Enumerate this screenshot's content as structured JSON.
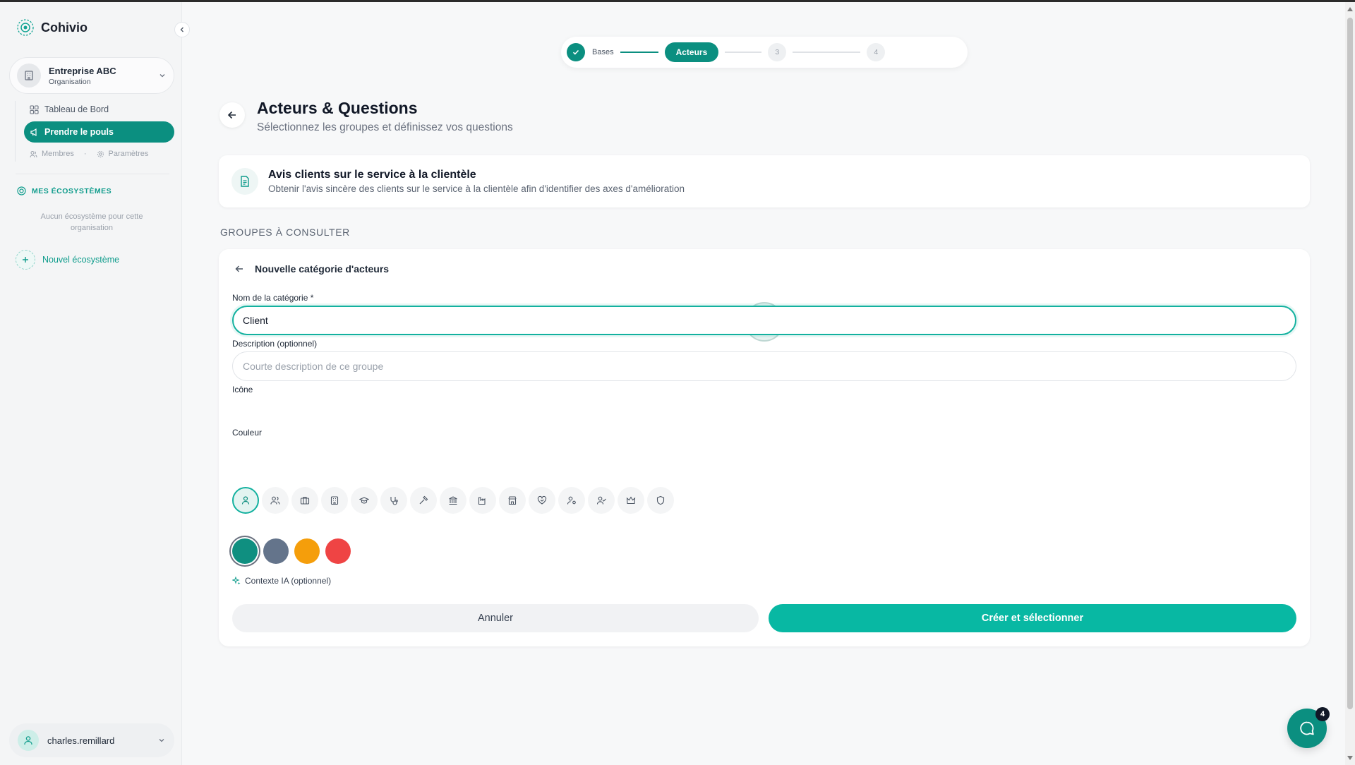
{
  "brand": {
    "name": "Cohivio"
  },
  "sidebar": {
    "org": {
      "name": "Entreprise ABC",
      "type": "Organisation"
    },
    "nav": [
      {
        "label": "Tableau de Bord",
        "icon": "grid-icon"
      },
      {
        "label": "Prendre le pouls",
        "icon": "megaphone-icon",
        "active": true
      }
    ],
    "sub_links": [
      {
        "label": "Membres",
        "icon": "users-icon"
      },
      {
        "label": "Paramètres",
        "icon": "gear-icon"
      }
    ],
    "section_label": "MES ÉCOSYSTÈMES",
    "empty_text": "Aucun écosystème pour cette organisation",
    "new_ecosystem": "Nouvel écosystème",
    "user": {
      "name": "charles.remillard"
    }
  },
  "stepper": {
    "steps": [
      {
        "label": "Bases",
        "state": "done"
      },
      {
        "label": "Acteurs",
        "state": "active"
      },
      {
        "label": "3",
        "state": "pending"
      },
      {
        "label": "4",
        "state": "pending"
      }
    ]
  },
  "page": {
    "title": "Acteurs & Questions",
    "subtitle": "Sélectionnez les groupes et définissez vos questions"
  },
  "survey": {
    "title": "Avis clients sur le service à la clientèle",
    "description": "Obtenir l'avis sincère des clients sur le service à la clientèle afin d'identifier des axes d'amélioration"
  },
  "groups_label": "GROUPES À CONSULTER",
  "form": {
    "title": "Nouvelle catégorie d'acteurs",
    "name_label": "Nom de la catégorie *",
    "name_value": "Client",
    "description_label": "Description (optionnel)",
    "description_placeholder": "Courte description de ce groupe",
    "icon_label": "Icône",
    "icons": [
      "user-icon",
      "users-icon",
      "briefcase-icon",
      "building-icon",
      "graduation-cap-icon",
      "stethoscope-icon",
      "hammer-icon",
      "landmark-icon",
      "factory-icon",
      "store-icon",
      "heart-handshake-icon",
      "user-cog-icon",
      "user-check-icon",
      "crown-icon",
      "shield-icon"
    ],
    "selected_icon": "user-icon",
    "color_label": "Couleur",
    "colors": [
      "#0f8f80",
      "#64748b",
      "#f59e0b",
      "#ef4444"
    ],
    "selected_color": "#0f8f80",
    "ai_context": "Contexte IA (optionnel)",
    "cancel": "Annuler",
    "submit": "Créer et sélectionner"
  },
  "chat": {
    "badge": "4"
  },
  "colors": {
    "accent": "#0b8f80",
    "accent_bright": "#08b8a3"
  }
}
